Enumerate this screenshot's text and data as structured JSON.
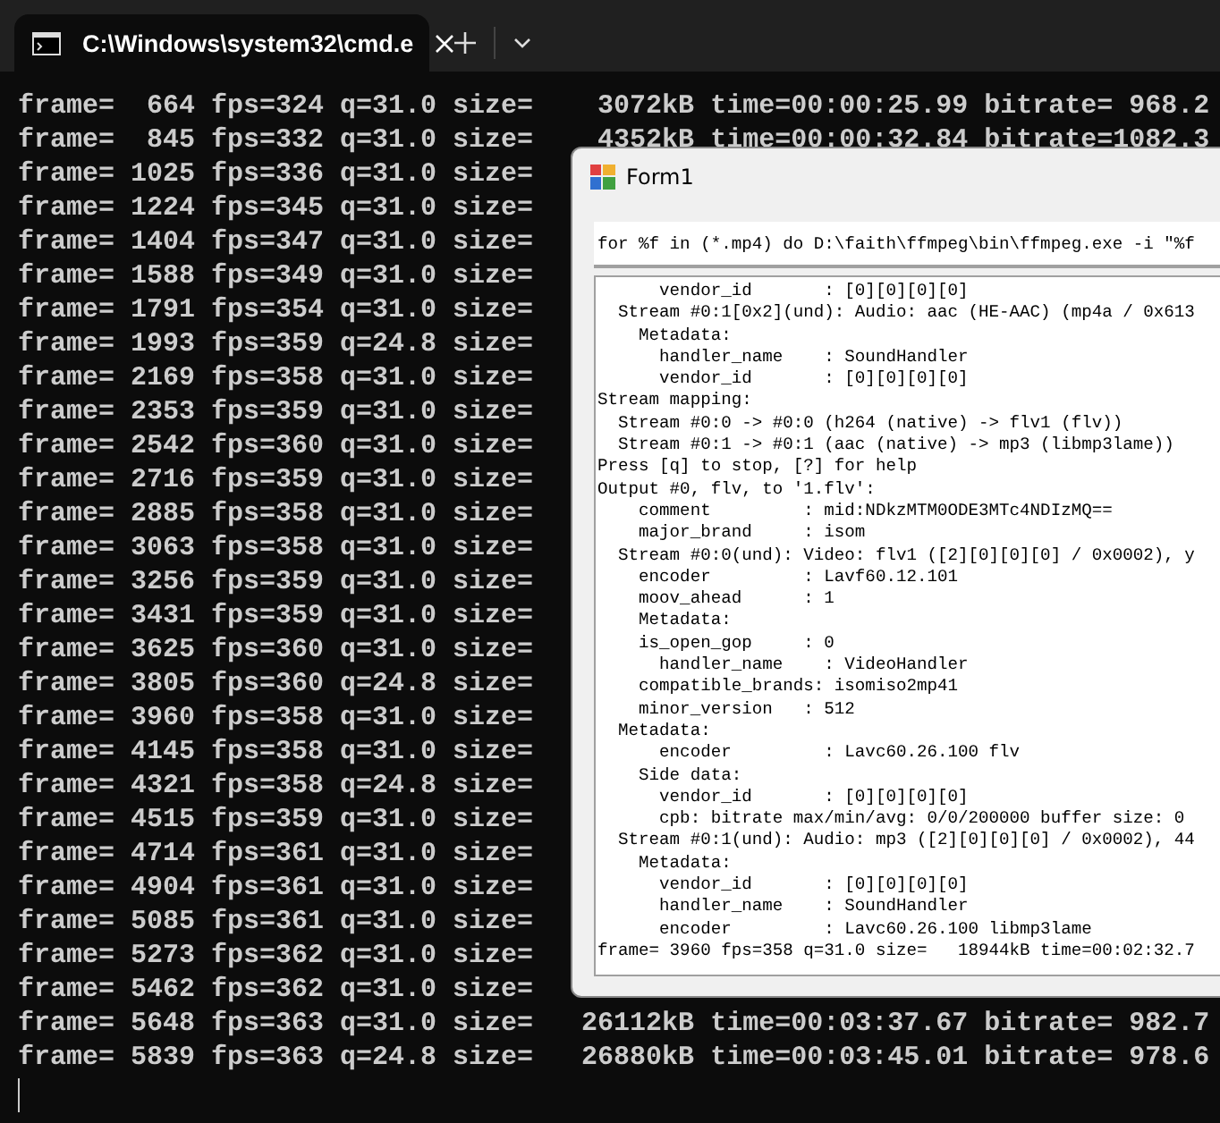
{
  "terminal_tab": {
    "title": "C:\\Windows\\system32\\cmd.e",
    "selected": true
  },
  "terminal": {
    "lines": [
      "frame=  664 fps=324 q=31.0 size=    3072kB time=00:00:25.99 bitrate= 968.2",
      "frame=  845 fps=332 q=31.0 size=    4352kB time=00:00:32.84 bitrate=1082.3",
      "frame= 1025 fps=336 q=31.0 size=",
      "frame= 1224 fps=345 q=31.0 size=",
      "frame= 1404 fps=347 q=31.0 size=",
      "frame= 1588 fps=349 q=31.0 size=",
      "frame= 1791 fps=354 q=31.0 size=",
      "frame= 1993 fps=359 q=24.8 size=",
      "frame= 2169 fps=358 q=31.0 size=",
      "frame= 2353 fps=359 q=31.0 size=",
      "frame= 2542 fps=360 q=31.0 size=",
      "frame= 2716 fps=359 q=31.0 size=",
      "frame= 2885 fps=358 q=31.0 size=",
      "frame= 3063 fps=358 q=31.0 size=",
      "frame= 3256 fps=359 q=31.0 size=",
      "frame= 3431 fps=359 q=31.0 size=",
      "frame= 3625 fps=360 q=31.0 size=",
      "frame= 3805 fps=360 q=24.8 size=",
      "frame= 3960 fps=358 q=31.0 size=",
      "frame= 4145 fps=358 q=31.0 size=",
      "frame= 4321 fps=358 q=24.8 size=",
      "frame= 4515 fps=359 q=31.0 size=",
      "frame= 4714 fps=361 q=31.0 size=",
      "frame= 4904 fps=361 q=31.0 size=",
      "frame= 5085 fps=361 q=31.0 size=",
      "frame= 5273 fps=362 q=31.0 size=",
      "frame= 5462 fps=362 q=31.0 size=",
      "frame= 5648 fps=363 q=31.0 size=   26112kB time=00:03:37.67 bitrate= 982.7",
      "frame= 5839 fps=363 q=24.8 size=   26880kB time=00:03:45.01 bitrate= 978.6"
    ]
  },
  "form": {
    "title": "Form1",
    "command": "for %f in (*.mp4) do D:\\faith\\ffmpeg\\bin\\ffmpeg.exe -i \"%f",
    "output_lines": [
      "      vendor_id       : [0][0][0][0]",
      "  Stream #0:1[0x2](und): Audio: aac (HE-AAC) (mp4a / 0x613",
      "    Metadata:",
      "      handler_name    : SoundHandler",
      "      vendor_id       : [0][0][0][0]",
      "Stream mapping:",
      "  Stream #0:0 -> #0:0 (h264 (native) -> flv1 (flv))",
      "  Stream #0:1 -> #0:1 (aac (native) -> mp3 (libmp3lame))",
      "Press [q] to stop, [?] for help",
      "Output #0, flv, to '1.flv':",
      "    comment         : mid:NDkzMTM0ODE3MTc4NDIzMQ==",
      "    major_brand     : isom",
      "  Stream #0:0(und): Video: flv1 ([2][0][0][0] / 0x0002), y",
      "    encoder         : Lavf60.12.101",
      "    moov_ahead      : 1",
      "    Metadata:",
      "    is_open_gop     : 0",
      "      handler_name    : VideoHandler",
      "    compatible_brands: isomiso2mp41",
      "    minor_version   : 512",
      "  Metadata:",
      "      encoder         : Lavc60.26.100 flv",
      "    Side data:",
      "      vendor_id       : [0][0][0][0]",
      "      cpb: bitrate max/min/avg: 0/0/200000 buffer size: 0",
      "  Stream #0:1(und): Audio: mp3 ([2][0][0][0] / 0x0002), 44",
      "    Metadata:",
      "      vendor_id       : [0][0][0][0]",
      "      handler_name    : SoundHandler",
      "      encoder         : Lavc60.26.100 libmp3lame",
      "frame= 3960 fps=358 q=31.0 size=   18944kB time=00:02:32.7"
    ]
  }
}
